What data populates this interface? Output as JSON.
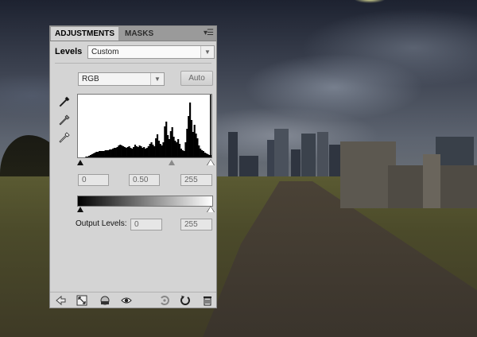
{
  "panel": {
    "tabs": [
      {
        "label": "ADJUSTMENTS"
      },
      {
        "label": "MASKS"
      }
    ],
    "menu_icon": "panel-menu-icon",
    "adjustment_name": "Levels",
    "preset": {
      "selected": "Custom"
    },
    "channel": {
      "selected": "RGB"
    },
    "auto_label": "Auto",
    "input_levels": {
      "black": "0",
      "gamma": "0.50",
      "white": "255"
    },
    "output_levels": {
      "label": "Output Levels:",
      "black": "0",
      "white": "255"
    },
    "eyedroppers": [
      "black-point-eyedropper-icon",
      "gray-point-eyedropper-icon",
      "white-point-eyedropper-icon"
    ],
    "bottom_icons": [
      "return-arrow-icon",
      "expanded-view-icon",
      "clip-to-layer-icon",
      "visibility-eye-icon",
      "view-previous-icon",
      "reset-icon",
      "delete-icon"
    ]
  },
  "histogram": [
    0,
    0,
    0,
    0,
    0,
    1,
    1,
    2,
    3,
    4,
    5,
    6,
    7,
    7,
    8,
    8,
    9,
    9,
    10,
    10,
    10,
    11,
    11,
    12,
    13,
    13,
    14,
    16,
    17,
    16,
    15,
    14,
    13,
    14,
    15,
    13,
    12,
    14,
    17,
    15,
    14,
    16,
    15,
    13,
    14,
    12,
    13,
    15,
    18,
    20,
    17,
    15,
    26,
    31,
    22,
    18,
    16,
    20,
    42,
    48,
    30,
    25,
    35,
    40,
    28,
    22,
    20,
    24,
    18,
    12,
    10,
    8,
    20,
    38,
    55,
    74,
    50,
    34,
    44,
    32,
    26,
    16,
    12,
    10,
    8,
    6,
    5,
    4,
    3,
    3
  ],
  "colors": {
    "panel_bg": "#d4d4d4",
    "tab_bar": "#9a9a9a",
    "histogram_fill": "#000000"
  }
}
